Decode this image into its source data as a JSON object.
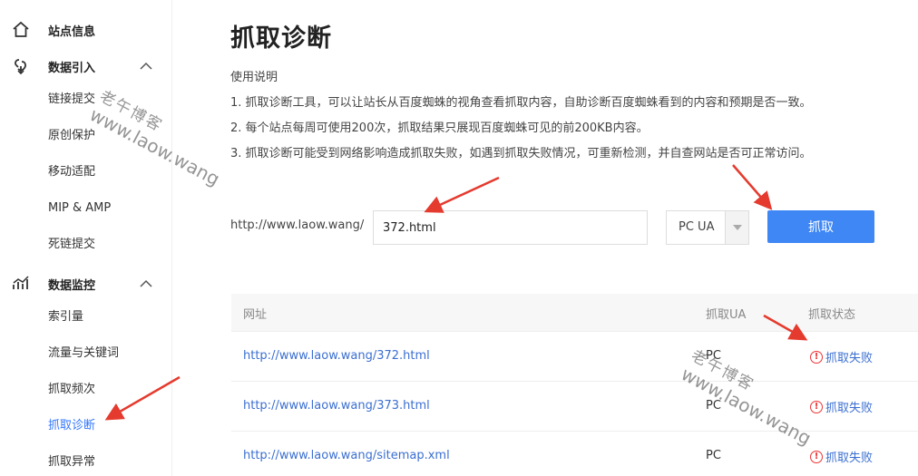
{
  "sidebar": {
    "site_info": "站点信息",
    "data_import": {
      "label": "数据引入",
      "items": [
        "链接提交",
        "原创保护",
        "移动适配",
        "MIP & AMP",
        "死链提交"
      ]
    },
    "data_monitor": {
      "label": "数据监控",
      "items": [
        "索引量",
        "流量与关键词",
        "抓取频次",
        "抓取诊断",
        "抓取异常"
      ]
    }
  },
  "main": {
    "title": "抓取诊断",
    "notes": [
      "使用说明",
      "1. 抓取诊断工具，可以让站长从百度蜘蛛的视角查看抓取内容，自助诊断百度蜘蛛看到的内容和预期是否一致。",
      "2. 每个站点每周可使用200次，抓取结果只展现百度蜘蛛可见的前200KB内容。",
      "3. 抓取诊断可能受到网络影响造成抓取失败，如遇到抓取失败情况，可重新检测，并自查网站是否可正常访问。"
    ],
    "url_prefix": "http://www.laow.wang/",
    "path_value": "372.html",
    "ua_value": "PC UA",
    "fetch_label": "抓取"
  },
  "table": {
    "headers": {
      "url": "网址",
      "ua": "抓取UA",
      "status": "抓取状态"
    },
    "rows": [
      {
        "url": "http://www.laow.wang/372.html",
        "ua": "PC",
        "status": "抓取失败"
      },
      {
        "url": "http://www.laow.wang/373.html",
        "ua": "PC",
        "status": "抓取失败"
      },
      {
        "url": "http://www.laow.wang/sitemap.xml",
        "ua": "PC",
        "status": "抓取失败"
      }
    ]
  },
  "watermark": {
    "name": "老午博客",
    "url": "www.laow.wang"
  },
  "colors": {
    "accent": "#3f87f5",
    "link": "#3b6fd1",
    "error": "#e33333",
    "arrow": "#e53a2e"
  }
}
